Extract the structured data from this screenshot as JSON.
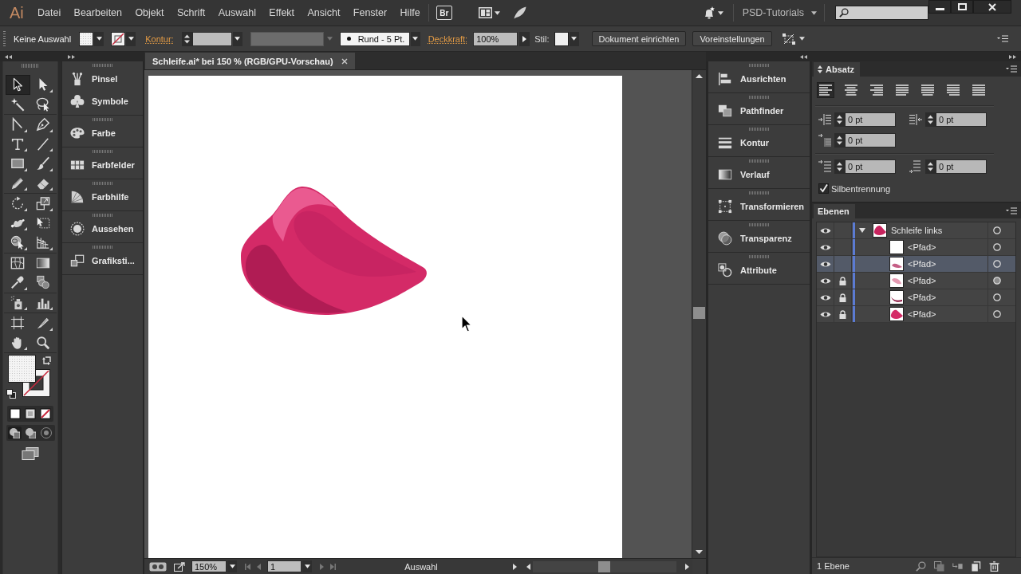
{
  "menu_bar": {
    "logo": "Ai",
    "items": [
      "Datei",
      "Bearbeiten",
      "Objekt",
      "Schrift",
      "Auswahl",
      "Effekt",
      "Ansicht",
      "Fenster",
      "Hilfe"
    ],
    "bridge": "Br",
    "workspace": "PSD-Tutorials"
  },
  "control_bar": {
    "selection": "Keine Auswahl",
    "stroke_label": "Kontur:",
    "brush": "Rund - 5 Pt.",
    "opacity_label": "Deckkraft:",
    "opacity": "100%",
    "style_label": "Stil:",
    "buttons": [
      "Dokument einrichten",
      "Voreinstellungen"
    ]
  },
  "tool_groups": [
    [
      {
        "kind": "selection",
        "selected": true,
        "flyout": false
      },
      {
        "kind": "direct",
        "selected": false,
        "flyout": true
      },
      {
        "kind": "wand",
        "selected": false,
        "flyout": false
      },
      {
        "kind": "lasso",
        "selected": false,
        "flyout": false
      }
    ],
    [
      {
        "kind": "curvature",
        "selected": false,
        "flyout": true
      },
      {
        "kind": "pen",
        "selected": false,
        "flyout": true
      },
      {
        "kind": "type",
        "selected": false,
        "flyout": true
      },
      {
        "kind": "line",
        "selected": false,
        "flyout": true
      },
      {
        "kind": "rectangle",
        "selected": false,
        "flyout": true
      },
      {
        "kind": "brush",
        "selected": false,
        "flyout": true
      },
      {
        "kind": "pencil",
        "selected": false,
        "flyout": true
      },
      {
        "kind": "eraser",
        "selected": false,
        "flyout": true
      }
    ],
    [
      {
        "kind": "rotate",
        "selected": false,
        "flyout": true
      },
      {
        "kind": "scale",
        "selected": false,
        "flyout": true
      },
      {
        "kind": "warp",
        "selected": false,
        "flyout": true
      },
      {
        "kind": "free-transform",
        "selected": false,
        "flyout": false
      },
      {
        "kind": "shape-builder",
        "selected": false,
        "flyout": true
      },
      {
        "kind": "perspective",
        "selected": false,
        "flyout": true
      }
    ],
    [
      {
        "kind": "mesh",
        "selected": false,
        "flyout": false
      },
      {
        "kind": "gradient",
        "selected": false,
        "flyout": false
      },
      {
        "kind": "eyedropper",
        "selected": false,
        "flyout": true
      },
      {
        "kind": "blend",
        "selected": false,
        "flyout": false
      }
    ],
    [
      {
        "kind": "sprayer",
        "selected": false,
        "flyout": true
      },
      {
        "kind": "graph",
        "selected": false,
        "flyout": true
      }
    ],
    [
      {
        "kind": "artboard",
        "selected": false,
        "flyout": false
      },
      {
        "kind": "slice",
        "selected": false,
        "flyout": true
      },
      {
        "kind": "hand",
        "selected": false,
        "flyout": true
      },
      {
        "kind": "zoom",
        "selected": false,
        "flyout": false
      }
    ]
  ],
  "draw_modes": [
    {
      "kind": "normal",
      "selected": true
    },
    {
      "kind": "behind",
      "selected": false
    },
    {
      "kind": "inside",
      "selected": false
    }
  ],
  "left_dock": [
    {
      "items": [
        {
          "kind": "brushes",
          "label": "Pinsel"
        },
        {
          "kind": "symbols",
          "label": "Symbole"
        }
      ]
    },
    {
      "items": [
        {
          "kind": "color",
          "label": "Farbe"
        }
      ]
    },
    {
      "items": [
        {
          "kind": "swatches",
          "label": "Farbfelder"
        }
      ]
    },
    {
      "items": [
        {
          "kind": "color-guide",
          "label": "Farbhilfe"
        }
      ]
    },
    {
      "items": [
        {
          "kind": "appearance",
          "label": "Aussehen"
        }
      ]
    },
    {
      "items": [
        {
          "kind": "graphic-styles",
          "label": "Grafiksti..."
        }
      ]
    }
  ],
  "document": {
    "tab": "Schleife.ai* bei 150 % (RGB/GPU-Vorschau)"
  },
  "status_bar": {
    "zoom": "150%",
    "page": "1",
    "info": "Auswahl"
  },
  "right_dock": [
    {
      "items": [
        {
          "kind": "align",
          "label": "Ausrichten"
        }
      ]
    },
    {
      "items": [
        {
          "kind": "pathfinder",
          "label": "Pathfinder"
        }
      ]
    },
    {
      "items": [
        {
          "kind": "stroke",
          "label": "Kontur"
        }
      ]
    },
    {
      "items": [
        {
          "kind": "gradient",
          "label": "Verlauf"
        }
      ]
    },
    {
      "items": [
        {
          "kind": "transform",
          "label": "Transformieren"
        }
      ]
    },
    {
      "items": [
        {
          "kind": "transparency",
          "label": "Transparenz"
        }
      ]
    },
    {
      "items": [
        {
          "kind": "attributes",
          "label": "Attribute"
        }
      ]
    }
  ],
  "paragraph_panel": {
    "title": "Absatz",
    "alignments": [
      {
        "kind": "left",
        "selected": true
      },
      {
        "kind": "center",
        "selected": false
      },
      {
        "kind": "right",
        "selected": false
      },
      {
        "kind": "justify-left",
        "selected": false
      },
      {
        "kind": "justify-center",
        "selected": false
      },
      {
        "kind": "justify-right",
        "selected": false
      },
      {
        "kind": "justify-all",
        "selected": false
      }
    ],
    "indent_rows": [
      [
        {
          "kind": "left-indent",
          "value": "0 pt"
        },
        {
          "kind": "right-indent",
          "value": "0 pt"
        }
      ],
      [
        {
          "kind": "first-line-indent",
          "value": "0 pt"
        }
      ]
    ],
    "spacing_row": [
      {
        "kind": "space-before",
        "value": "0 pt"
      },
      {
        "kind": "space-after",
        "value": "0 pt"
      }
    ],
    "hyphenation": {
      "label": "Silbentrennung",
      "checked": true
    }
  },
  "layers_panel": {
    "title": "Ebenen",
    "layers": [
      {
        "name": "Schleife links",
        "kind": "loop",
        "visible": true,
        "locked": false,
        "expanded": true,
        "selected": false,
        "appearance": false,
        "children": [
          {
            "name": "<Pfad>",
            "kind": "blank",
            "visible": true,
            "locked": false,
            "selected": false,
            "appearance": false
          },
          {
            "name": "<Pfad>",
            "kind": "highlight",
            "visible": true,
            "locked": false,
            "selected": true,
            "appearance": false
          },
          {
            "name": "<Pfad>",
            "kind": "light",
            "visible": true,
            "locked": true,
            "selected": false,
            "appearance": true
          },
          {
            "name": "<Pfad>",
            "kind": "shadow",
            "visible": true,
            "locked": true,
            "selected": false,
            "appearance": false
          },
          {
            "name": "<Pfad>",
            "kind": "base",
            "visible": true,
            "locked": true,
            "selected": false,
            "appearance": false
          }
        ]
      }
    ],
    "footer": "1 Ebene"
  }
}
